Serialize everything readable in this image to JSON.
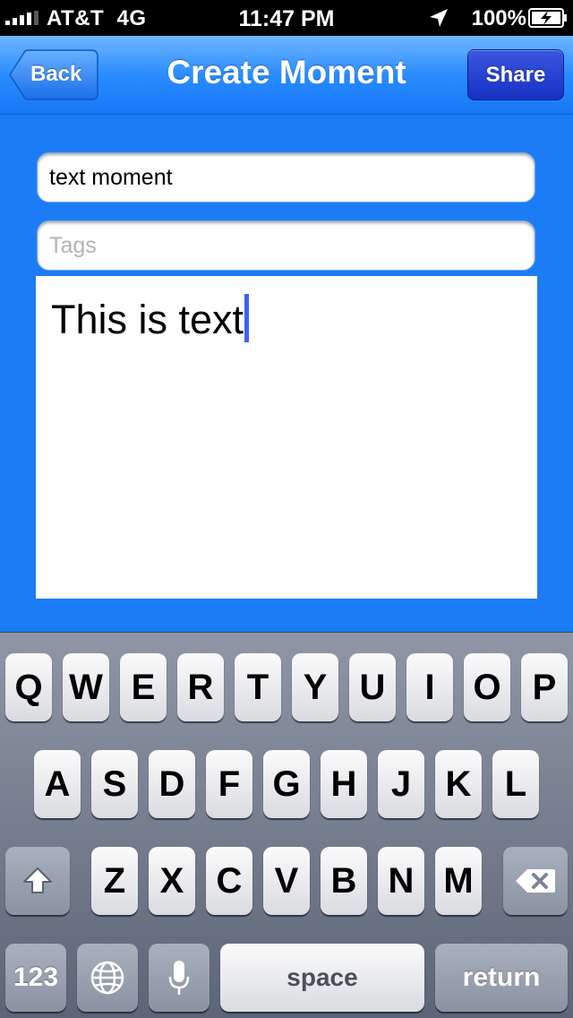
{
  "status_bar": {
    "carrier": "AT&T",
    "network": "4G",
    "time": "11:47 PM",
    "battery_percent": "100%",
    "icons": [
      "signal-icon",
      "location-arrow-icon",
      "battery-charging-icon"
    ]
  },
  "nav": {
    "title": "Create Moment",
    "back_label": "Back",
    "share_label": "Share"
  },
  "form": {
    "title_value": "text moment",
    "tags_placeholder": "Tags",
    "tags_value": "",
    "body_text": "This is text"
  },
  "keyboard": {
    "row1": [
      "Q",
      "W",
      "E",
      "R",
      "T",
      "Y",
      "U",
      "I",
      "O",
      "P"
    ],
    "row2": [
      "A",
      "S",
      "D",
      "F",
      "G",
      "H",
      "J",
      "K",
      "L"
    ],
    "row3": [
      "Z",
      "X",
      "C",
      "V",
      "B",
      "N",
      "M"
    ],
    "numbers_label": "123",
    "space_label": "space",
    "return_label": "return",
    "icons": [
      "shift-icon",
      "backspace-icon",
      "globe-icon",
      "microphone-icon"
    ]
  },
  "colors": {
    "content_bg": "#1c7cf6",
    "share_button": "#2740d6",
    "cursor": "#3d63f0"
  }
}
